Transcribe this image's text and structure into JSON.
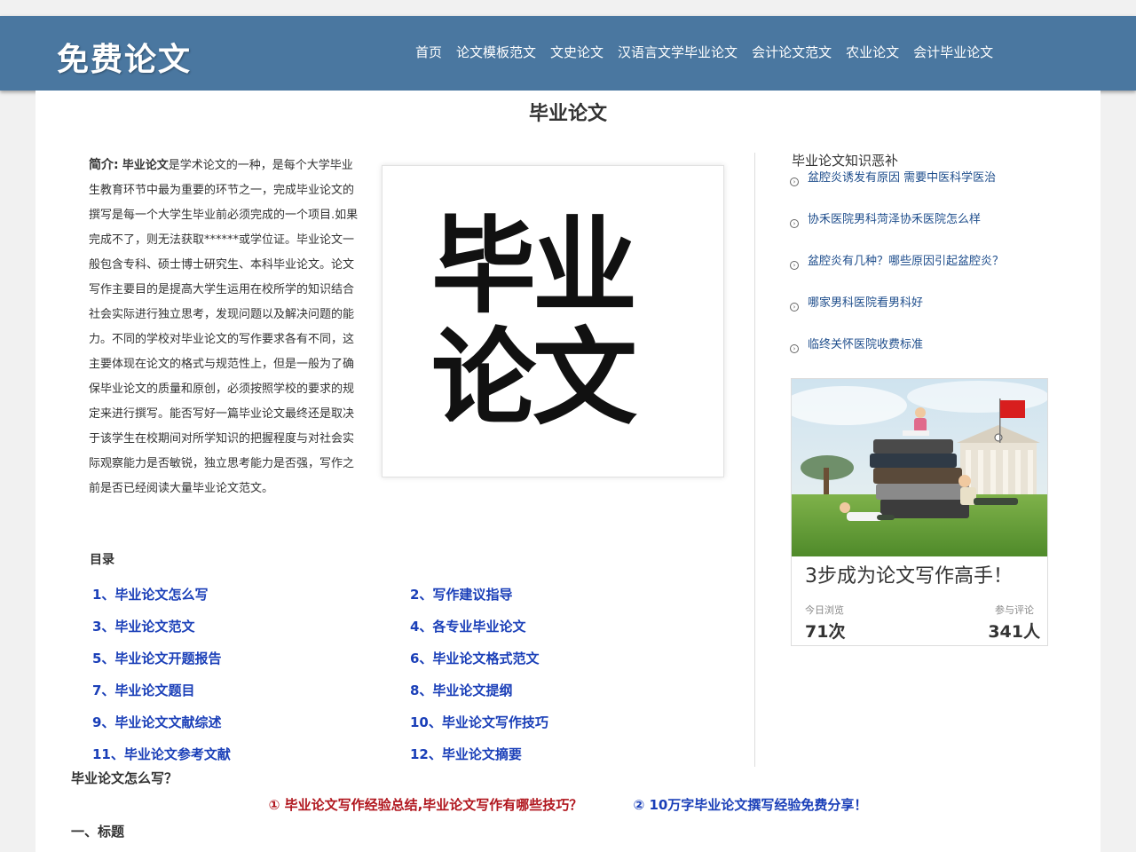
{
  "header": {
    "logo": "免费论文",
    "nav": [
      "首页",
      "论文模板范文",
      "文史论文",
      "汉语言文学毕业论文",
      "会计论文范文",
      "农业论文",
      "会计毕业论文"
    ]
  },
  "page_title": "毕业论文",
  "intro": {
    "label": "简介:",
    "term": "毕业论文",
    "text": "是学术论文的一种，是每个大学毕业生教育环节中最为重要的环节之一，完成毕业论文的撰写是每一个大学生毕业前必须完成的一个项目.如果完成不了，则无法获取******或学位证。毕业论文一般包含专科、硕士博士研究生、本科毕业论文。论文写作主要目的是提高大学生运用在校所学的知识结合社会实际进行独立思考，发现问题以及解决问题的能力。不同的学校对毕业论文的写作要求各有不同，这主要体现在论文的格式与规范性上，但是一般为了确保毕业论文的质量和原创，必须按照学校的要求的规定来进行撰写。能否写好一篇毕业论文最终还是取决于该学生在校期间对所学知识的把握程度与对社会实际观察能力是否敏锐，独立思考能力是否强，写作之前是否已经阅读大量毕业论文范文。"
  },
  "cover": {
    "line1": "毕业",
    "line2": "论文"
  },
  "toc": {
    "title": "目录",
    "items": [
      "1、毕业论文怎么写",
      "2、写作建议指导",
      "3、毕业论文范文",
      "4、各专业毕业论文",
      "5、毕业论文开题报告",
      "6、毕业论文格式范文",
      "7、毕业论文题目",
      "8、毕业论文提纲",
      "9、毕业论文文献综述",
      "10、毕业论文写作技巧",
      "11、毕业论文参考文献",
      "12、毕业论文摘要"
    ]
  },
  "section_question": "毕业论文怎么写？",
  "promo": {
    "link1": "① 毕业论文写作经验总结,毕业论文写作有哪些技巧？",
    "link2": "② 10万字毕业论文撰写经验免费分享！"
  },
  "section_heading": "一、标题",
  "sidebar": {
    "title": "毕业论文知识恶补",
    "links": [
      "盆腔炎诱发有原因 需要中医科学医治",
      "协禾医院男科菏泽协禾医院怎么样",
      "盆腔炎有几种？哪些原因引起盆腔炎？",
      "哪家男科医院看男科好",
      "临终关怀医院收费标准"
    ]
  },
  "ad": {
    "caption": "3步成为论文写作高手！",
    "views_label": "今日浏览",
    "views": "71次",
    "comments_label": "参与评论",
    "comments": "341人"
  }
}
